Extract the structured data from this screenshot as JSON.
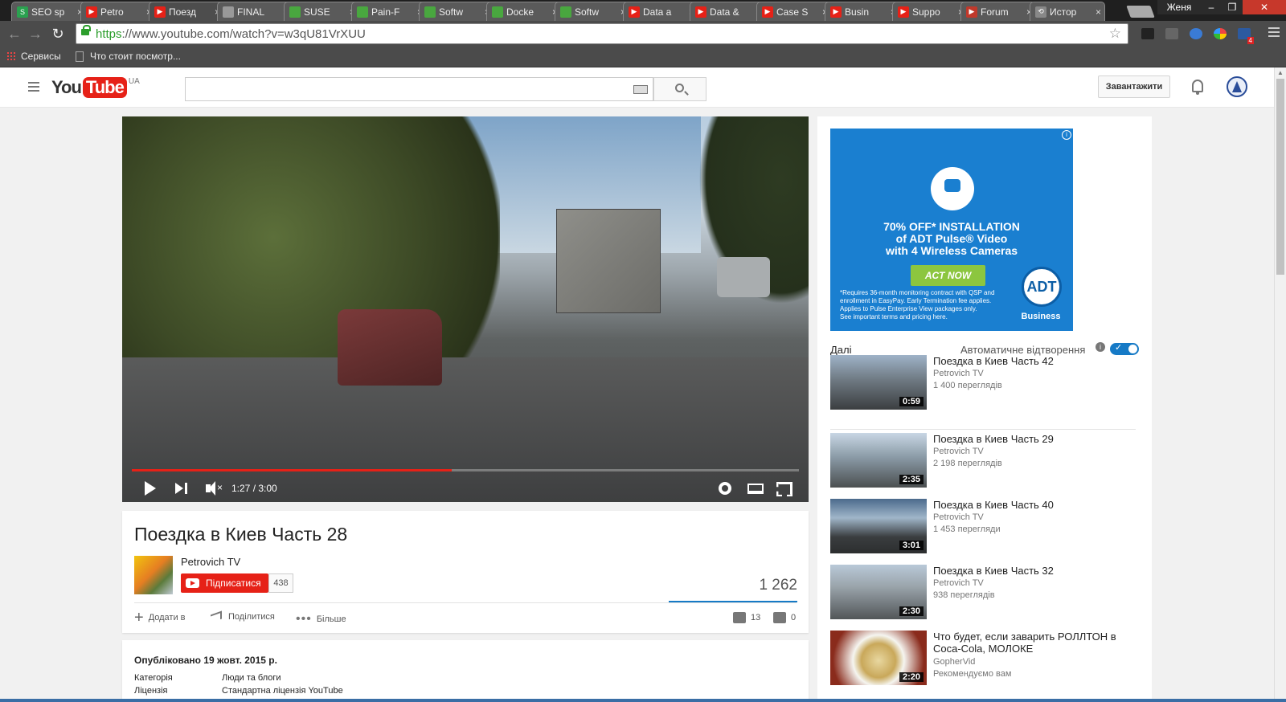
{
  "browser": {
    "tabs": [
      {
        "title": "SEO sp",
        "color": "#2aa14f",
        "glyph": "S"
      },
      {
        "title": "Petro",
        "color": "#e62117",
        "glyph": "▶"
      },
      {
        "title": "Поезд",
        "color": "#e62117",
        "glyph": "▶"
      },
      {
        "title": "FINAL",
        "color": "#999999",
        "glyph": ""
      },
      {
        "title": "SUSE",
        "color": "#49a73f",
        "glyph": ""
      },
      {
        "title": "Pain-F",
        "color": "#49a73f",
        "glyph": ""
      },
      {
        "title": "Softw",
        "color": "#49a73f",
        "glyph": ""
      },
      {
        "title": "Docke",
        "color": "#49a73f",
        "glyph": ""
      },
      {
        "title": "Softw",
        "color": "#49a73f",
        "glyph": ""
      },
      {
        "title": "Data a",
        "color": "#e62117",
        "glyph": "▶"
      },
      {
        "title": "Data &",
        "color": "#e62117",
        "glyph": "▶"
      },
      {
        "title": "Case S",
        "color": "#e62117",
        "glyph": "▶"
      },
      {
        "title": "Busin",
        "color": "#e62117",
        "glyph": "▶"
      },
      {
        "title": "Suppo",
        "color": "#e62117",
        "glyph": "▶"
      },
      {
        "title": "Forum",
        "color": "#c0392b",
        "glyph": "▶"
      },
      {
        "title": "Истор",
        "color": "#888888",
        "glyph": "⟲"
      }
    ],
    "close_glyph": "×",
    "user": "Женя",
    "window_buttons": {
      "minimize": "–",
      "restore": "❐",
      "close": "✕"
    },
    "url_scheme": "https",
    "url_rest": "://www.youtube.com/watch?v=w3qU81VrXUU",
    "star_glyph": "☆",
    "extension_badge": "4",
    "bookmarks": [
      {
        "label": "Сервисы",
        "icon": "apps-icon"
      },
      {
        "label": "Что стоит посмотр...",
        "icon": "page-icon"
      }
    ]
  },
  "youtube": {
    "logo_you": "You",
    "logo_tube": "Tube",
    "logo_region": "UA",
    "search_placeholder": "",
    "upload_label": "Завантажити"
  },
  "player": {
    "time": "1:27 / 3:00",
    "progress": 0.48,
    "mute_glyph": "×"
  },
  "video": {
    "title": "Поездка в Киев Часть 28",
    "channel": "Petrovich TV",
    "subscribe_label": "Підписатися",
    "subscriber_count": "438",
    "views": "1 262",
    "actions": {
      "add": "Додати в",
      "share": "Поділитися",
      "more": "Більше"
    },
    "likes": "13",
    "dislikes": "0",
    "published": "Опубліковано 19 жовт. 2015 р.",
    "category_label": "Категорія",
    "category_value": "Люди та блоги",
    "license_label": "Ліцензія",
    "license_value": "Стандартна ліцензія YouTube"
  },
  "ad": {
    "info_glyph": "i",
    "headline_1": "70% OFF* INSTALLATION",
    "headline_2": "of ADT Pulse® Video",
    "headline_3": "with 4 Wireless Cameras",
    "cta": "ACT NOW",
    "fine_print_1": "*Requires 36-month monitoring contract with QSP and",
    "fine_print_2": "enrollment in EasyPay. Early Termination fee applies.",
    "fine_print_3": "Applies to Pulse Enterprise View packages only.",
    "fine_print_4": "See important terms and pricing here.",
    "brand": "ADT",
    "brand_sub": "Business",
    "bg_color": "#1a7fd0"
  },
  "sidebar": {
    "up_next_label": "Далі",
    "autoplay_label": "Автоматичне відтворення",
    "autoplay_on": true,
    "recommendations": [
      {
        "title": "Поездка в Киев Часть 42",
        "channel": "Petrovich TV",
        "views": "1 400 переглядів",
        "duration": "0:59"
      },
      {
        "title": "Поездка в Киев Часть 29",
        "channel": "Petrovich TV",
        "views": "2 198 переглядів",
        "duration": "2:35"
      },
      {
        "title": "Поездка в Киев Часть 40",
        "channel": "Petrovich TV",
        "views": "1 453 перегляди",
        "duration": "3:01"
      },
      {
        "title": "Поездка в Киев Часть 32",
        "channel": "Petrovich TV",
        "views": "938 переглядів",
        "duration": "2:30"
      },
      {
        "title": "Что будет, если заварить РОЛЛТОН в Coca-Cola, МОЛОКЕ",
        "channel": "GopherVid",
        "views": "Рекомендуємо вам",
        "duration": "2:20"
      }
    ]
  }
}
